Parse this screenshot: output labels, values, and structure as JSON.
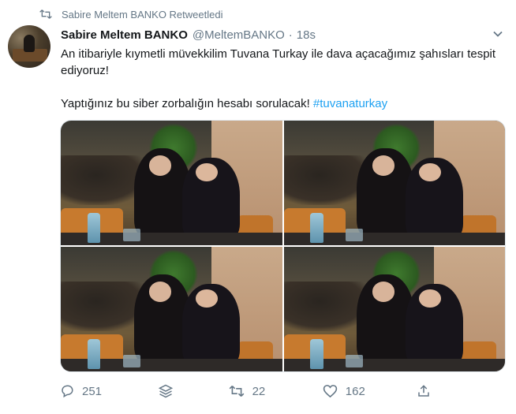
{
  "retweet_banner": {
    "icon": "retweet-icon",
    "text": "Sabire Meltem BANKO Retweetledi"
  },
  "tweet": {
    "author": {
      "display_name": "Sabire Meltem BANKO",
      "handle": "@MeltemBANKO",
      "separator": "·",
      "time": "18s"
    },
    "text_line1": "An itibariyle kıymetli müvekkilim Tuvana Turkay ile dava açacağımız şahısları tespit ediyoruz!",
    "text_line2_plain": "Yaptığınız bu siber zorbalığın hesabı sorulacak!",
    "hashtag": "#tuvanaturkay",
    "media": [
      {
        "icon": "photo"
      },
      {
        "icon": "photo"
      },
      {
        "icon": "photo"
      },
      {
        "icon": "photo"
      }
    ],
    "actions": {
      "reply_count": "251",
      "retweet_count": "22",
      "like_count": "162"
    }
  },
  "colors": {
    "link": "#1da1f2",
    "muted": "#657786",
    "text": "#14171a"
  }
}
